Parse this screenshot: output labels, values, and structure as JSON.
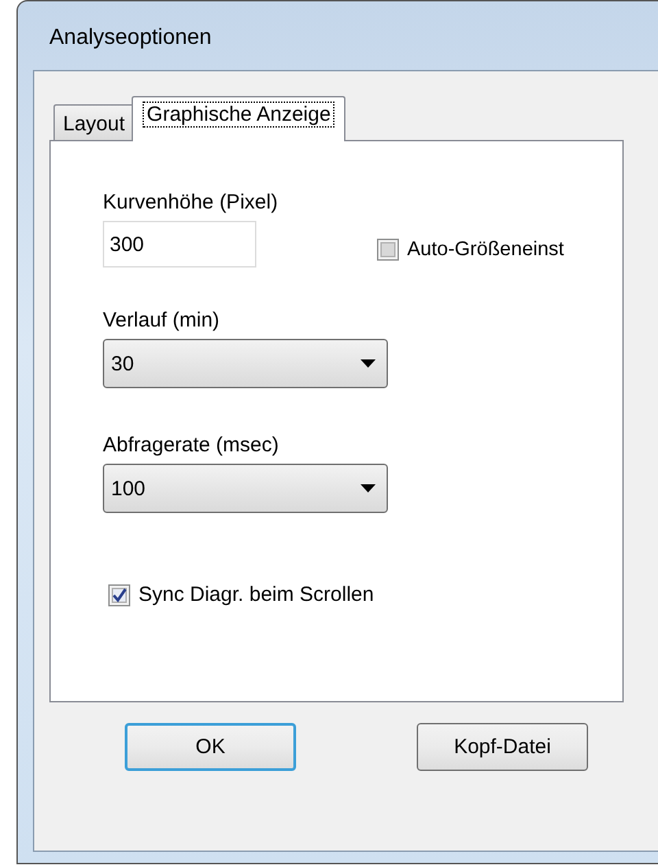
{
  "window": {
    "title": "Analyseoptionen"
  },
  "tabs": [
    {
      "label": "Layout",
      "selected": false
    },
    {
      "label": "Graphische Anzeige",
      "selected": true
    }
  ],
  "panel": {
    "fields": [
      {
        "kind": "text",
        "label": "Kurvenhöhe (Pixel)",
        "value": "300",
        "checkbox": {
          "label": "Auto-Größeneinst",
          "checked": false
        }
      },
      {
        "kind": "combo",
        "label": "Verlauf (min)",
        "value": "30"
      },
      {
        "kind": "combo",
        "label": "Abfragerate (msec)",
        "value": "100"
      },
      {
        "kind": "check",
        "label": "Sync Diagr. beim Scrollen",
        "checked": true
      }
    ]
  },
  "buttons": [
    {
      "label": "OK",
      "default": true
    },
    {
      "label": "Kopf-Datei",
      "default": false
    }
  ]
}
